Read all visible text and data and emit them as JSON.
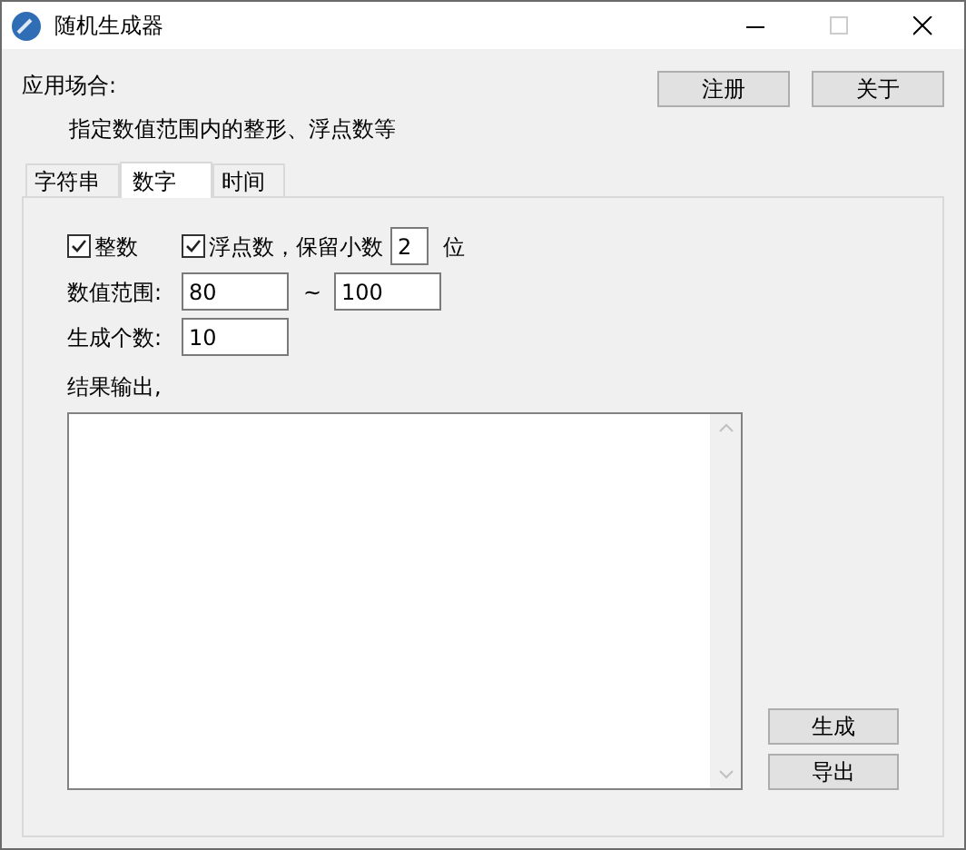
{
  "window": {
    "title": "随机生成器"
  },
  "header": {
    "label": "应用场合:",
    "description": "指定数值范围内的整形、浮点数等",
    "buttons": [
      "注册",
      "关于"
    ]
  },
  "tabs": [
    {
      "label": "字符串",
      "selected": false
    },
    {
      "label": "数字",
      "selected": true
    },
    {
      "label": "时间",
      "selected": false
    }
  ],
  "options": {
    "integer": {
      "label": "整数",
      "checked": true
    },
    "float": {
      "label": "浮点数，保留小数",
      "checked": true,
      "decimals": "2",
      "unit": "位"
    }
  },
  "range": {
    "label": "数值范围:",
    "min": "80",
    "separator": "~",
    "max": "100"
  },
  "count": {
    "label": "生成个数:",
    "value": "10"
  },
  "output": {
    "label": "结果输出,"
  },
  "actions": [
    "生成",
    "导出"
  ]
}
